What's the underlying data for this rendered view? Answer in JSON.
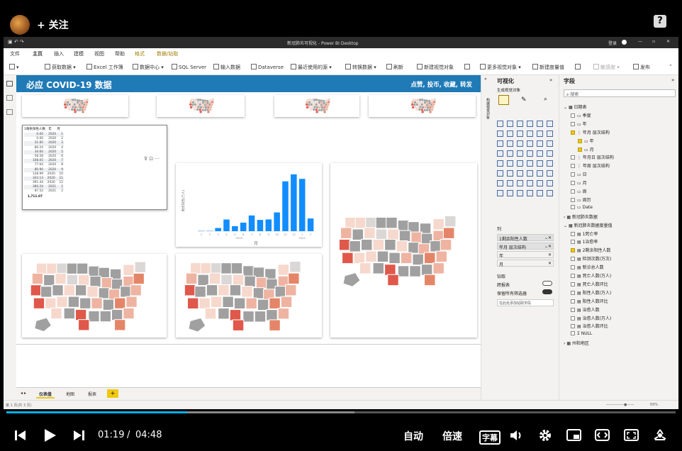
{
  "uploader": {
    "follow_label": "+ 关注"
  },
  "help_label": "?",
  "window": {
    "title": "新冠肺炎可视化 - Power BI Desktop",
    "login": "登录",
    "controls": [
      "—",
      "▫",
      "✕"
    ]
  },
  "menu": {
    "items": [
      "文件",
      "主页",
      "插入",
      "建模",
      "视图",
      "帮助",
      "格式",
      "数据/钻取"
    ]
  },
  "ribbon": {
    "items": [
      "获取数据",
      "Excel 工作簿",
      "数据中心",
      "SQL Server",
      "输入数据",
      "Dataverse",
      "最近使用的源",
      "转换数据",
      "刷新",
      "新建视觉对象",
      "更多视觉对象",
      "新建度量值",
      "敏感度",
      "发布"
    ]
  },
  "report": {
    "header_title": "必应 COVID-19 数据",
    "header_links": "点赞, 投币, 收藏, 转发"
  },
  "table": {
    "headers": [
      "1剩余阳性人数",
      "年",
      "月"
    ],
    "rows": [
      [
        "0.00",
        "2020",
        "1"
      ],
      [
        "0.00",
        "2020",
        "2"
      ],
      [
        "21.85",
        "2020",
        "3"
      ],
      [
        "80.24",
        "2020",
        "4"
      ],
      [
        "34.60",
        "2020",
        "5"
      ],
      [
        "58.58",
        "2020",
        "6"
      ],
      [
        "108.05",
        "2020",
        "7"
      ],
      [
        "77.64",
        "2020",
        "8"
      ],
      [
        "80.90",
        "2020",
        "9"
      ],
      [
        "128.99",
        "2020",
        "10"
      ],
      [
        "343.13",
        "2020",
        "11"
      ],
      [
        "391.44",
        "2020",
        "12"
      ],
      [
        "360.24",
        "2021",
        "1"
      ],
      [
        "87.52",
        "2021",
        "2"
      ]
    ],
    "total": "1,711.07"
  },
  "chart_data": {
    "type": "bar",
    "categories": [
      "1",
      "2",
      "3",
      "4",
      "5",
      "6",
      "7",
      "8",
      "9",
      "10",
      "11",
      "12",
      "1",
      "2"
    ],
    "values": [
      0,
      0,
      21.85,
      80.24,
      34.6,
      58.58,
      108.05,
      77.64,
      80.9,
      128.99,
      343.13,
      391.44,
      360.24,
      87.52
    ],
    "year_labels": [
      "2020",
      "2021"
    ],
    "xlabel": "月",
    "ylabel": "剩余阳性(万人)",
    "ylim": [
      0,
      420
    ],
    "color": "#118dff"
  },
  "viz_pane": {
    "title": "可视化",
    "subtitle": "生成视觉对象",
    "build_tab": "构建视觉对象",
    "section_columns": "列",
    "wells": [
      "1剩余阳性人数",
      "年月 层次结构",
      "年",
      "月"
    ],
    "section_drill": "钻取",
    "cross_report": "跨报表",
    "keep_filters": "保留所有筛选器",
    "drill_placeholder": "在此处添加钻取字段"
  },
  "field_pane": {
    "title": "字段",
    "search_placeholder": "搜索",
    "items": [
      {
        "label": "日期表",
        "level": 0,
        "icon": "table"
      },
      {
        "label": "季度",
        "level": 1,
        "icon": "field"
      },
      {
        "label": "年",
        "level": 1,
        "icon": "field"
      },
      {
        "label": "年月 层次结构",
        "level": 1,
        "icon": "hier",
        "checked": true
      },
      {
        "label": "年",
        "level": 2,
        "icon": "field",
        "checked": true
      },
      {
        "label": "月",
        "level": 2,
        "icon": "field",
        "checked": true
      },
      {
        "label": "年月日 层次结构",
        "level": 1,
        "icon": "hier"
      },
      {
        "label": "年周 层次结构",
        "level": 1,
        "icon": "hier"
      },
      {
        "label": "日",
        "level": 1,
        "icon": "field"
      },
      {
        "label": "月",
        "level": 1,
        "icon": "field"
      },
      {
        "label": "周",
        "level": 1,
        "icon": "field"
      },
      {
        "label": "周历",
        "level": 1,
        "icon": "field"
      },
      {
        "label": "Date",
        "level": 1,
        "icon": "field"
      },
      {
        "label": "新冠肺炎数据",
        "level": 0,
        "icon": "table"
      },
      {
        "label": "新冠肺炎数据度量值",
        "level": 0,
        "icon": "table"
      },
      {
        "label": "1死亡率",
        "level": 1,
        "icon": "measure"
      },
      {
        "label": "1治愈率",
        "level": 1,
        "icon": "measure"
      },
      {
        "label": "2剩余阳性人数",
        "level": 1,
        "icon": "measure",
        "checked": true
      },
      {
        "label": "检测次数(万次)",
        "level": 1,
        "icon": "measure"
      },
      {
        "label": "新诊总人数",
        "level": 1,
        "icon": "measure"
      },
      {
        "label": "死亡人数(万人)",
        "level": 1,
        "icon": "measure"
      },
      {
        "label": "死亡人数环比",
        "level": 1,
        "icon": "measure"
      },
      {
        "label": "阳性人数(万人)",
        "level": 1,
        "icon": "measure"
      },
      {
        "label": "阳性人数环比",
        "level": 1,
        "icon": "measure"
      },
      {
        "label": "治愈人数",
        "level": 1,
        "icon": "measure"
      },
      {
        "label": "治愈人数(万人)",
        "level": 1,
        "icon": "measure"
      },
      {
        "label": "治愈人数环比",
        "level": 1,
        "icon": "measure"
      },
      {
        "label": "NULL",
        "level": 1,
        "icon": "sigma"
      },
      {
        "label": "州和地区",
        "level": 0,
        "icon": "table"
      }
    ]
  },
  "page_tabs": {
    "items": [
      "仪表盘",
      "地图",
      "报表"
    ],
    "add": "+"
  },
  "status": {
    "page": "第 1 页(共 3 页)",
    "zoom": "69%"
  },
  "player": {
    "current_time": "01:19",
    "separator": "/",
    "total_time": "04:48",
    "progress": 0.27,
    "buffered": 0.52,
    "auto_label": "自动",
    "speed_label": "倍速",
    "subtitle_label": "字幕"
  }
}
